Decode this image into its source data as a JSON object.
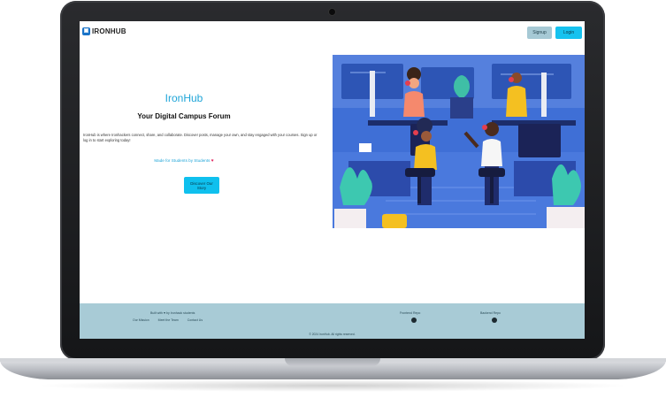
{
  "nav": {
    "brand": "IRONHUB",
    "signup_label": "Signup",
    "login_label": "Login"
  },
  "hero": {
    "title": "IronHub",
    "subtitle": "Your Digital Campus Forum",
    "description": "IronHub is where Ironhackers connect, share, and collaborate. Discover posts, manage your own, and stay engaged with your courses. Sign up or log in to start exploring today!",
    "made_by": "Made for Students by Students",
    "cta_label": "Discover Our Story"
  },
  "footer": {
    "made_with": "Built with ♥ by Ironhack students",
    "links": [
      "Our Mission",
      "Meet the Team",
      "Contact Us"
    ],
    "col2_title": "Frontend Repo",
    "col3_title": "Backend Repo",
    "copyright": "© 2024 IronHub. All rights reserved."
  },
  "colors": {
    "accent": "#16c2ef",
    "brand_blue": "#1fa5d8",
    "footer_bg": "#a8cbd6",
    "signup_bg": "#a6c9d5",
    "heart": "#e0245e"
  },
  "icons": {
    "logo": "ironhub-logo-icon",
    "footer_repo": "github-icon",
    "heart": "heart-icon"
  }
}
